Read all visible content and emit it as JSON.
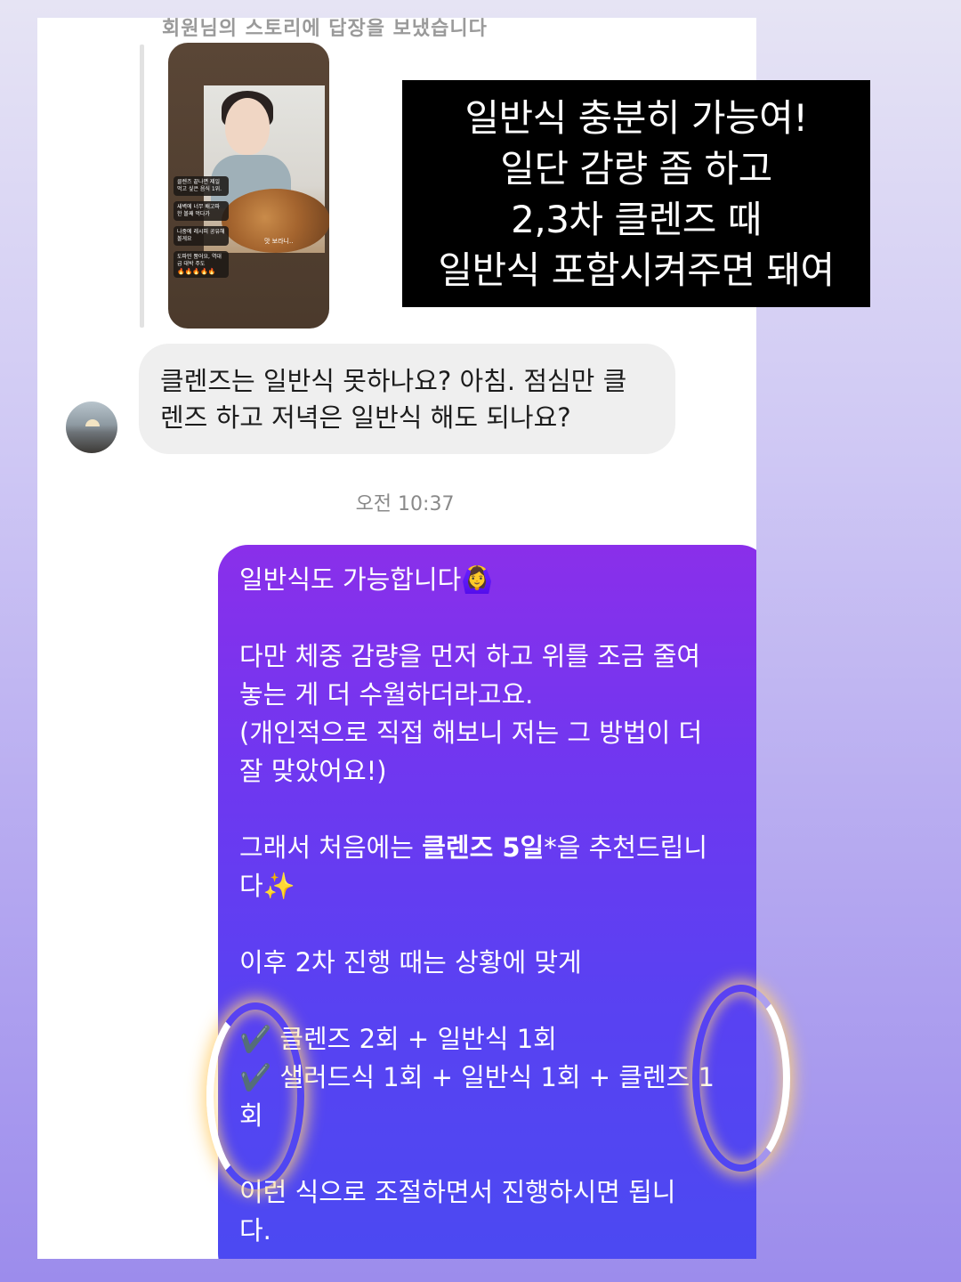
{
  "chat": {
    "top_cut_text": "회원님의 스토리에 답장을 보냈습니다",
    "story": {
      "notes": [
        "클렌즈 끝나면 제일 먹고 싶은 음식 1위.",
        "새벽에 너무 배고파 한 볼째 먹다가",
        "나중에 레시피 공유해볼게요",
        "도파민 뿜어요, 역대급 대박 주도"
      ],
      "fires": "🔥🔥🔥🔥🔥",
      "caption": "맛 보라니.."
    },
    "incoming": {
      "line1": "클렌즈는 일반식 못하나요? 아침. 점심만 클",
      "line2": "렌즈 하고 저녁은 일반식 해도 되나요?"
    },
    "timestamp": "오전 10:37",
    "outgoing": {
      "l1": "일반식도 가능합니다🙆‍♀️",
      "l2": "다만 체중 감량을 먼저 하고 위를 조금 줄여",
      "l3": "놓는 게 더 수월하더라고요.",
      "l4": "(개인적으로 직접 해보니 저는 그 방법이 더",
      "l5": "잘 맞았어요!)",
      "l6a": "그래서 처음에는 ",
      "l6b": "클렌즈 5일",
      "l6c": "*을 추천드립니",
      "l7": "다✨",
      "l8": "이후 2차 진행 때는 상황에 맞게",
      "l9": "✔️ 클렌즈 2회 + 일반식 1회",
      "l10": "✔️ 샐러드식 1회 + 일반식 1회 + 클렌즈 1",
      "l11": "회",
      "l12": "이런 식으로 조절하면서 진행하시면 됩니",
      "l13": "다."
    }
  },
  "overlay": {
    "line1": "일반식 충분히 가능여!",
    "line2": "일단 감량 좀 하고",
    "line3": "2,3차 클렌즈 때",
    "line4": "일반식 포함시켜주면 돼여"
  },
  "colors": {
    "bubble_top": "#8a2fea",
    "bubble_bottom": "#4a4af2",
    "incoming_bg": "#efefef",
    "page_bg": "#b3a6f0"
  }
}
